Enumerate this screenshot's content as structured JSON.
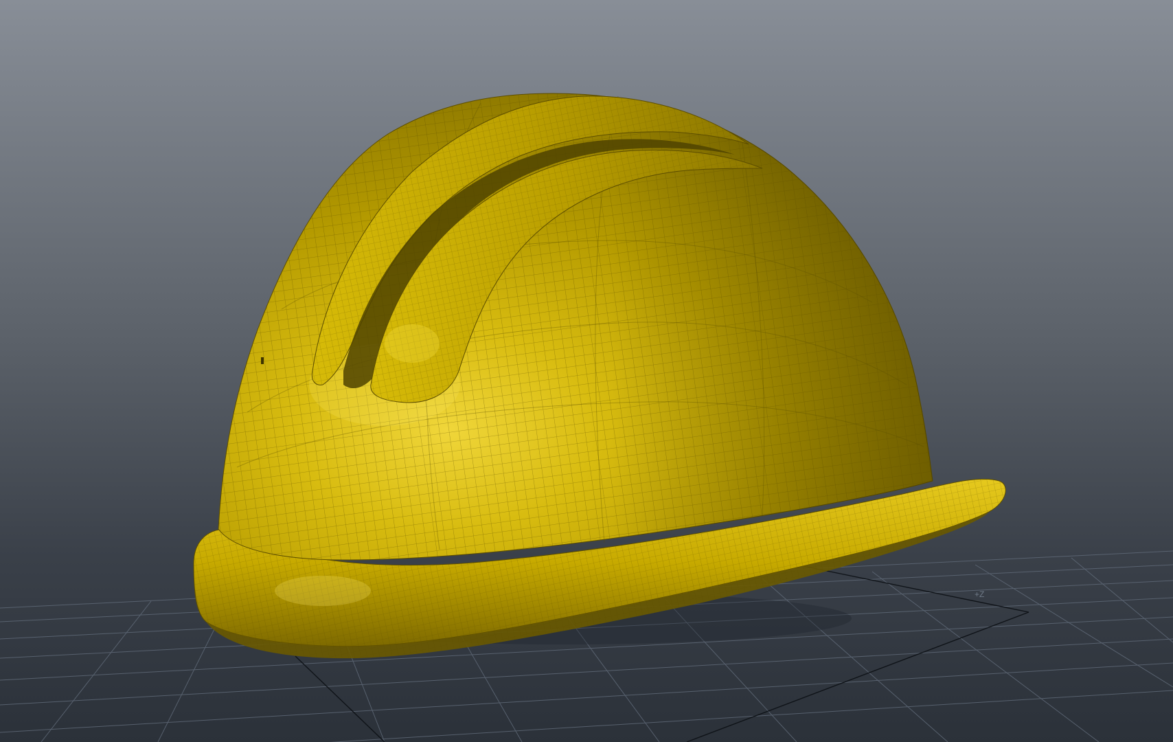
{
  "viewport": {
    "axis_label": "+Z",
    "colors": {
      "background_top": "#878c95",
      "background_mid": "#5a6068",
      "background_bottom": "#2e343d",
      "grid_line": "#5d6775",
      "axis_line": "#0f1318",
      "helmet_base": "#c9ac00",
      "helmet_highlight": "#efd43a",
      "helmet_shadow": "#6e5e00",
      "wire": "#5a4c00"
    },
    "object": {
      "name_icon": "hard-hat-icon",
      "display": "wireframe-on-shaded"
    }
  }
}
